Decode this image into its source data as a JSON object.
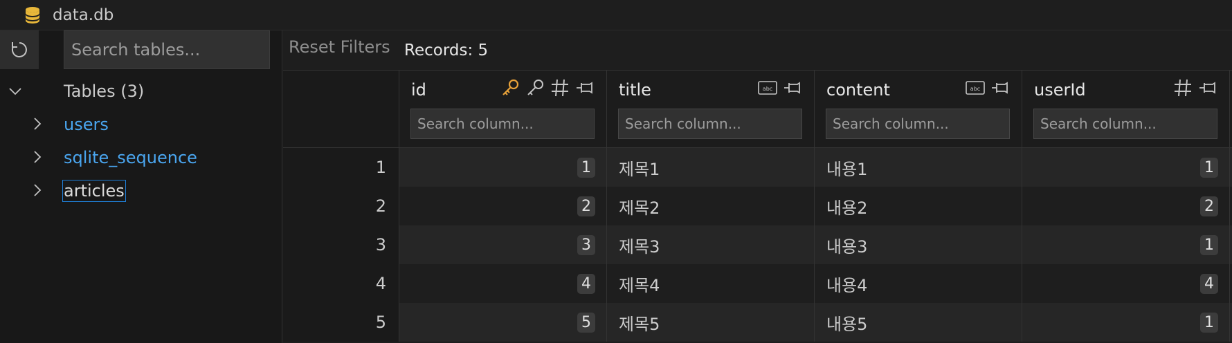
{
  "window": {
    "title": "data.db"
  },
  "sidebar": {
    "search_placeholder": "Search tables...",
    "tables_header": "Tables (3)",
    "tables": [
      "users",
      "sqlite_sequence",
      "articles"
    ],
    "selected": "articles"
  },
  "toolbar": {
    "reset_label": "Reset Filters",
    "records_label": "Records: 5"
  },
  "columns": [
    {
      "name": "id",
      "icons": [
        "primary-key-icon",
        "key-icon",
        "hash-icon",
        "pin-icon"
      ]
    },
    {
      "name": "title",
      "icons": [
        "abc-icon",
        "pin-icon"
      ]
    },
    {
      "name": "content",
      "icons": [
        "abc-icon",
        "pin-icon"
      ]
    },
    {
      "name": "userId",
      "icons": [
        "hash-icon",
        "pin-icon"
      ]
    }
  ],
  "column_search_placeholder": "Search column...",
  "rows": [
    {
      "n": "1",
      "id": "1",
      "title": "제목1",
      "content": "내용1",
      "userId": "1"
    },
    {
      "n": "2",
      "id": "2",
      "title": "제목2",
      "content": "내용2",
      "userId": "2"
    },
    {
      "n": "3",
      "id": "3",
      "title": "제목3",
      "content": "내용3",
      "userId": "1"
    },
    {
      "n": "4",
      "id": "4",
      "title": "제목4",
      "content": "내용4",
      "userId": "4"
    },
    {
      "n": "5",
      "id": "5",
      "title": "제목5",
      "content": "내용5",
      "userId": "1"
    }
  ],
  "colors": {
    "accent_key": "#e8a23a",
    "link": "#4aa6f0",
    "selection": "#1f7fd8"
  }
}
